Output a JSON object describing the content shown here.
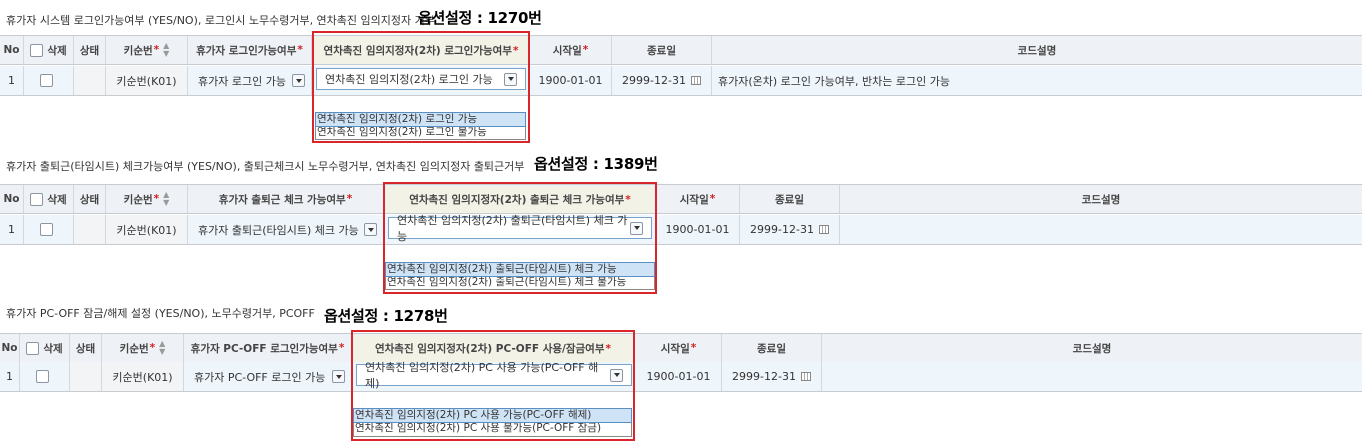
{
  "sections": [
    {
      "title": "휴가자 시스템 로그인가능여부 (YES/NO), 로그인시 노무수령거부, 연차촉진 임의지정자 거부",
      "option": "옵션설정 : 1270번",
      "headers": {
        "no": "No",
        "delete": "삭제",
        "status": "상태",
        "key": "키순번",
        "col1": "휴가자 로그인가능여부",
        "col2": "연차촉진 임의지정자(2차) 로그인가능여부",
        "start": "시작일",
        "end": "종료일",
        "desc": "코드설명"
      },
      "row": {
        "no": "1",
        "key": "키순번(K01)",
        "col1": "휴가자 로그인 가능",
        "col2": "연차촉진 임의지정(2차) 로그인 가능",
        "start": "1900-01-01",
        "end": "2999-12-31",
        "desc": "휴가자(온차) 로그인 가능여부, 반차는 로그인 가능"
      },
      "options": [
        "연차촉진 임의지정(2차) 로그인 가능",
        "연차촉진 임의지정(2차) 로그인 불가능"
      ]
    },
    {
      "title": "휴가자 출퇴근(타임시트) 체크가능여부 (YES/NO), 출퇴근체크시 노무수령거부, 연차촉진 임의지정자 출퇴근거부",
      "option": "옵션설정 : 1389번",
      "headers": {
        "no": "No",
        "delete": "삭제",
        "status": "상태",
        "key": "키순번",
        "col1": "휴가자 출퇴근 체크 가능여부",
        "col2": "연차촉진 임의지정자(2차) 출퇴근 체크 가능여부",
        "start": "시작일",
        "end": "종료일",
        "desc": "코드설명"
      },
      "row": {
        "no": "1",
        "key": "키순번(K01)",
        "col1": "휴가자 출퇴근(타임시트) 체크 가능",
        "col2": "연차촉진 임의지정(2차) 출퇴근(타임시트) 체크 가능",
        "start": "1900-01-01",
        "end": "2999-12-31",
        "desc": ""
      },
      "options": [
        "연차촉진 임의지정(2차) 출퇴근(타임시트) 체크 가능",
        "연차촉진 임의지정(2차) 출퇴근(타임시트) 체크 불가능"
      ]
    },
    {
      "title": "휴가자 PC-OFF 잠금/해제 설정 (YES/NO), 노무수령거부, PCOFF",
      "option": "옵션설정 : 1278번",
      "headers": {
        "no": "No",
        "delete": "삭제",
        "status": "상태",
        "key": "키순번",
        "col1": "휴가자 PC-OFF 로그인가능여부",
        "col2": "연차촉진 임의지정자(2차) PC-OFF 사용/잠금여부",
        "start": "시작일",
        "end": "종료일",
        "desc": "코드설명"
      },
      "row": {
        "no": "1",
        "key": "키순번(K01)",
        "col1": "휴가자 PC-OFF 로그인 가능",
        "col2": "연차촉진 임의지정(2차) PC 사용 가능(PC-OFF 해제)",
        "start": "1900-01-01",
        "end": "2999-12-31",
        "desc": ""
      },
      "options": [
        "연차촉진 임의지정(2차) PC 사용 가능(PC-OFF 해제)",
        "연차촉진 임의지정(2차) PC 사용 불가능(PC-OFF 잠금)"
      ]
    }
  ],
  "colors": {
    "highlight_box": "#d9262b",
    "required": "#d32020",
    "row_bg": "#eef5fb",
    "header_bg": "#eef1f5"
  }
}
